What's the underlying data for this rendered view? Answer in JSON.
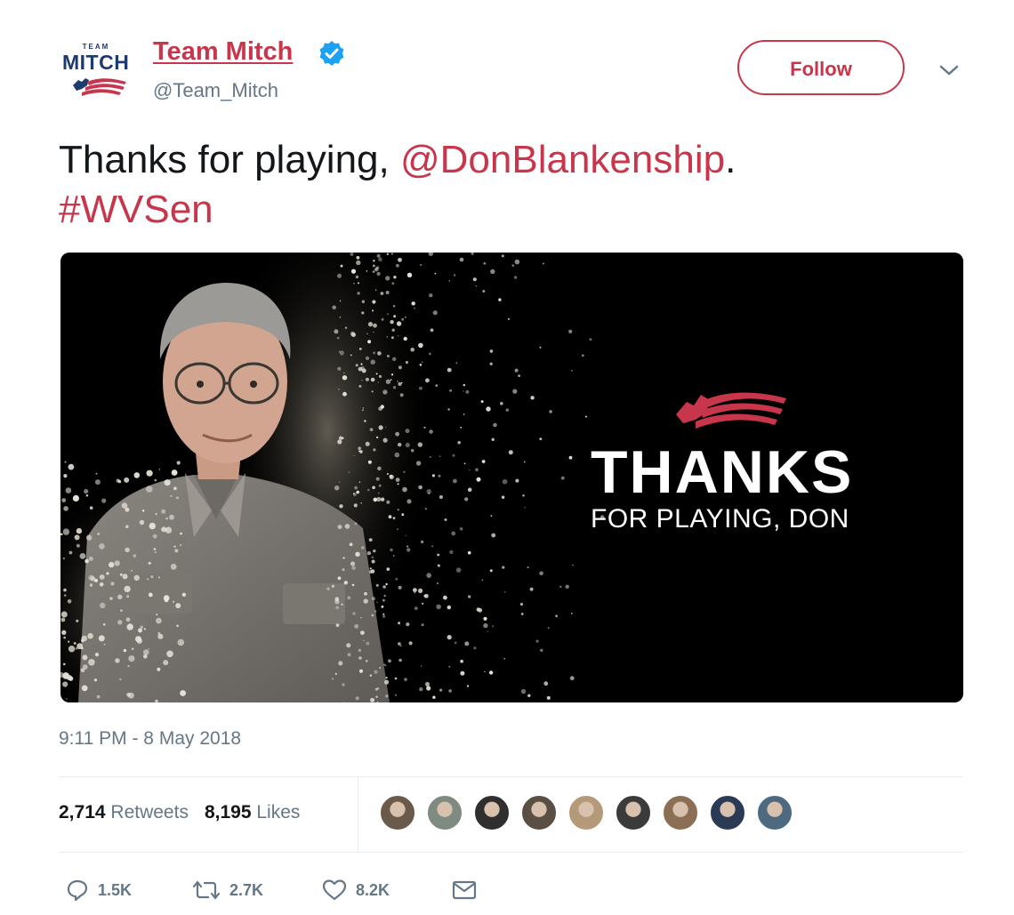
{
  "account": {
    "avatar_team": "TEAM",
    "avatar_mitch": "MITCH",
    "name": "Team Mitch",
    "handle": "@Team_Mitch",
    "verified": true,
    "follow_label": "Follow"
  },
  "tweet": {
    "text_prefix": "Thanks for playing, ",
    "mention": "@DonBlankenship",
    "text_suffix": ".",
    "hashtag": "#WVSen",
    "timestamp": "9:11 PM - 8 May 2018"
  },
  "media": {
    "headline": "THANKS",
    "subline": "FOR PLAYING, DON"
  },
  "stats": {
    "retweets_count": "2,714",
    "retweets_label": "Retweets",
    "likes_count": "8,195",
    "likes_label": "Likes",
    "liker_avatar_count": 9
  },
  "actions": {
    "reply_count": "1.5K",
    "retweet_count": "2.7K",
    "like_count": "8.2K"
  },
  "colors": {
    "accent": "#c8364c",
    "navy": "#1f3a6e",
    "muted": "#657786",
    "verified": "#1da1f2"
  },
  "icons": [
    "verified-badge-icon",
    "chevron-down-icon",
    "reply-icon",
    "retweet-icon",
    "heart-icon",
    "mail-icon"
  ]
}
